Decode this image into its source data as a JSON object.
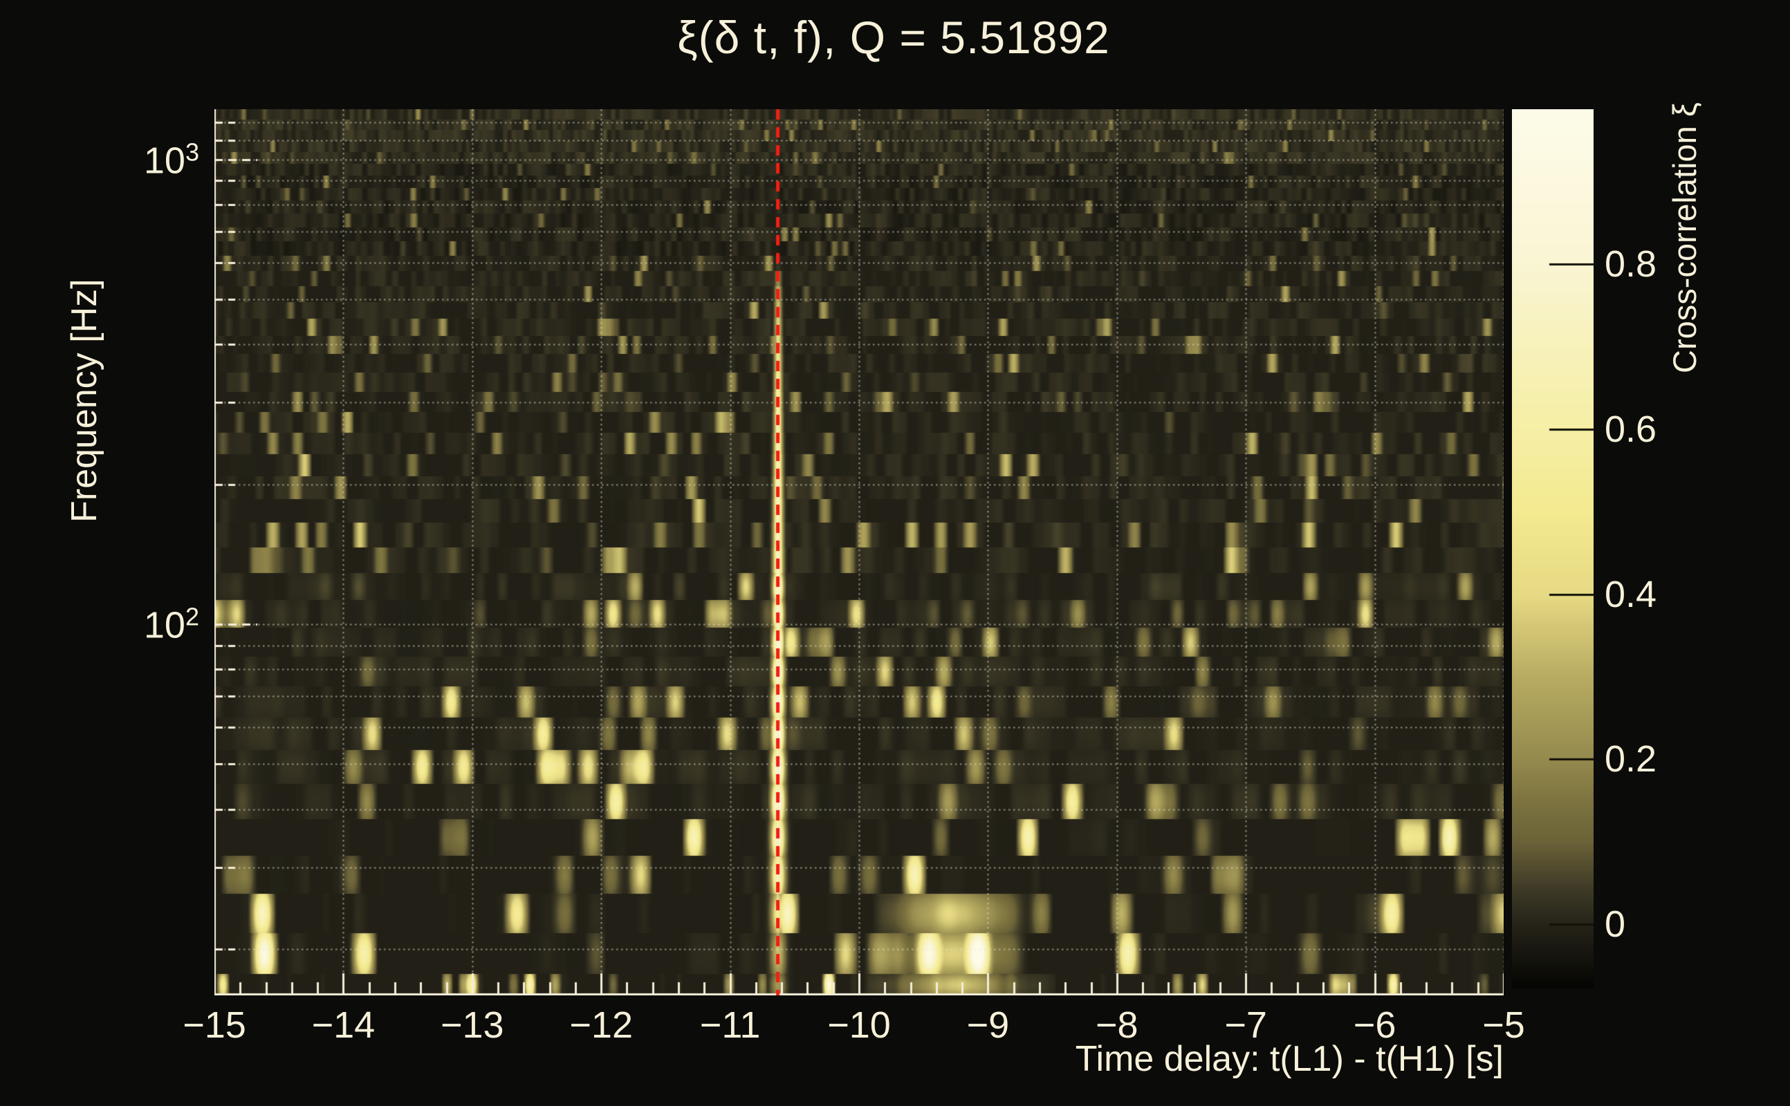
{
  "figure": {
    "background": "#0b0b09",
    "text_color": "#f7f1da",
    "axis_color": "#f3edd8"
  },
  "chart_data": {
    "type": "heatmap",
    "title": "ξ(δ t, f), Q = 5.51892",
    "q_value": 5.51892,
    "xlabel": "Time delay: t(L1) - t(H1) [s]",
    "ylabel": "Frequency [Hz]",
    "colorbar_label": "Cross-correlation ξ",
    "x_axis": {
      "min": -15,
      "max": -5,
      "major_ticks": [
        -15,
        -14,
        -13,
        -12,
        -11,
        -10,
        -9,
        -8,
        -7,
        -6,
        -5
      ],
      "tick_labels": [
        "−15",
        "−14",
        "−13",
        "−12",
        "−11",
        "−10",
        "−9",
        "−8",
        "−7",
        "−6",
        "−5"
      ],
      "minor_tick_step": 0.2,
      "gridlines": [
        -14,
        -13,
        -12,
        -11,
        -10,
        -9,
        -8,
        -7,
        -6,
        -5
      ],
      "grid_style": "dotted"
    },
    "y_axis": {
      "scale": "log",
      "min": 15.9,
      "max": 1282,
      "major_ticks": [
        {
          "value": 1000,
          "label_base": "10",
          "label_exp": "3"
        },
        {
          "value": 100,
          "label_base": "10",
          "label_exp": "2"
        }
      ],
      "minor_ticks": [
        20,
        30,
        40,
        50,
        60,
        70,
        80,
        90,
        200,
        300,
        400,
        500,
        600,
        700,
        800,
        900,
        1100,
        1200
      ],
      "grid_style": "dotted"
    },
    "colorbar": {
      "min": -0.077,
      "max": 0.988,
      "ticks": [
        {
          "value": 0.0,
          "label": "0"
        },
        {
          "value": 0.2,
          "label": "0.2"
        },
        {
          "value": 0.4,
          "label": "0.4"
        },
        {
          "value": 0.6,
          "label": "0.6"
        },
        {
          "value": 0.8,
          "label": "0.8"
        }
      ],
      "palette": [
        {
          "xi": -0.077,
          "color": "#050503"
        },
        {
          "xi": 0.0,
          "color": "#262419"
        },
        {
          "xi": 0.05,
          "color": "#433f29"
        },
        {
          "xi": 0.1,
          "color": "#6b6238"
        },
        {
          "xi": 0.15,
          "color": "#7d7440"
        },
        {
          "xi": 0.2,
          "color": "#958a4e"
        },
        {
          "xi": 0.3,
          "color": "#b8ac62"
        },
        {
          "xi": 0.4,
          "color": "#e6da84"
        },
        {
          "xi": 0.5,
          "color": "#f4ea90"
        },
        {
          "xi": 0.6,
          "color": "#f6efa6"
        },
        {
          "xi": 0.7,
          "color": "#f8f2bb"
        },
        {
          "xi": 0.8,
          "color": "#faf5d3"
        },
        {
          "xi": 0.9,
          "color": "#fcf9e0"
        },
        {
          "xi": 0.988,
          "color": "#fdfce9"
        }
      ]
    },
    "signal_line": {
      "time_delay": -10.63,
      "style": "dashed",
      "color": "#f41e12",
      "description": "red dashed vertical marker over a bright cross-correlation streak"
    },
    "heatmap_description": "Q-transform style time-frequency tiling; dark-olive noise background with brighter khaki vertical streaks, high-contrast wide blobs in the lowest-frequency rows, and one strong pale-yellow correlation streak at the marked time delay"
  }
}
